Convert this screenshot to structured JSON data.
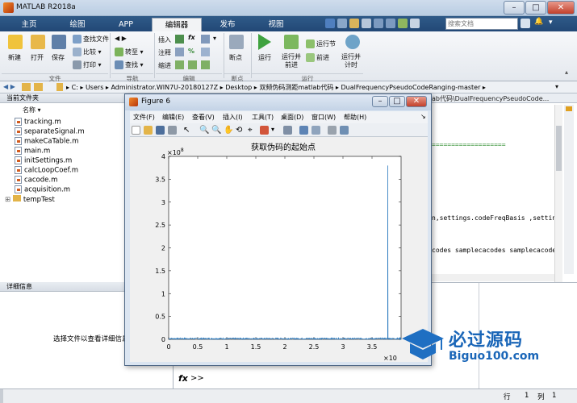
{
  "window": {
    "title": "MATLAB R2018a"
  },
  "tabs": [
    "主页",
    "绘图",
    "APP",
    "编辑器",
    "发布",
    "视图"
  ],
  "active_tab": "编辑器",
  "search": {
    "placeholder": "搜索文档"
  },
  "ribbon": {
    "file_group": {
      "label": "文件",
      "new": "新建",
      "open": "打开",
      "save": "保存",
      "find_files": "查找文件",
      "compare": "比较",
      "print": "打印"
    },
    "nav_group": {
      "label": "导航",
      "goto": "转至",
      "find": "查找"
    },
    "edit_group": {
      "label": "编辑",
      "insert": "插入",
      "comment": "注释",
      "indent": "缩进"
    },
    "breakpoint_group": {
      "label": "断点",
      "breakpoints": "断点"
    },
    "run_group": {
      "label": "运行",
      "run": "运行",
      "run_advance": "运行并前进",
      "run_section": "运行节",
      "advance": "前进",
      "run_time": "运行并计时"
    }
  },
  "address_bar": {
    "segments": [
      "C:",
      "Users",
      "Administrator.WIN7U-20180127Z",
      "Desktop",
      "双频伪码测距matlab代码",
      "DualFrequencyPseudoCodeRanging-master"
    ]
  },
  "folder_panel": {
    "title": "当前文件夹",
    "column": "名称",
    "files": [
      "tracking.m",
      "separateSignal.m",
      "makeCaTable.m",
      "main.m",
      "initSettings.m",
      "calcLoopCoef.m",
      "cacode.m",
      "acquisition.m"
    ],
    "folder": "tempTest"
  },
  "detail_panel": {
    "title": "详细信息",
    "message": "选择文件以查看详细信息"
  },
  "editor": {
    "path_fragment": "ab代码\\DualFrequencyPseudoCode...",
    "lines": [
      "===================",
      "n,settings.codeFreqBasis ,settin",
      "codes samplecacodes samplecacode"
    ]
  },
  "command_window": {
    "prompt": ">>",
    "fx": "fx"
  },
  "status_bar": {
    "row_label": "行",
    "row": "1",
    "col_label": "列",
    "col": "1"
  },
  "figure": {
    "title": "Figure 6",
    "menu": [
      "文件(F)",
      "编辑(E)",
      "查看(V)",
      "插入(I)",
      "工具(T)",
      "桌面(D)",
      "窗口(W)",
      "帮助(H)"
    ]
  },
  "chart_data": {
    "type": "line",
    "title": "获取伪码的起始点",
    "xlim": [
      0,
      4
    ],
    "ylim": [
      0,
      4
    ],
    "x_multiplier": "×10",
    "y_multiplier": "×10^8",
    "x_ticks": [
      "0",
      "0.5",
      "1",
      "1.5",
      "2",
      "2.5",
      "3",
      "3.5"
    ],
    "y_ticks": [
      "0",
      "0.5",
      "1",
      "1.5",
      "2",
      "2.5",
      "3",
      "3.5",
      "4"
    ],
    "series": [
      {
        "color": "#2d7bbf",
        "noise_level": 0.03,
        "peak": {
          "x": 3.77,
          "y": 3.8
        }
      }
    ]
  },
  "watermark": {
    "text": "必过源码",
    "url": "Biguo100.com"
  }
}
